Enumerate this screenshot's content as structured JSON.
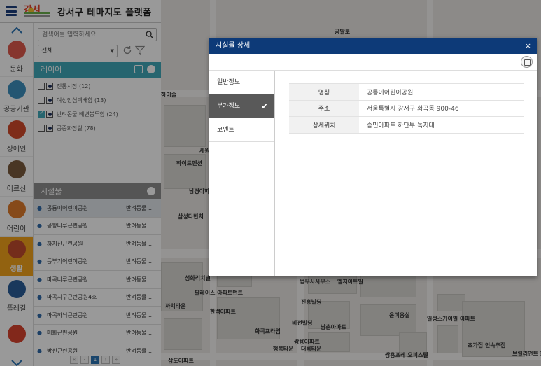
{
  "header": {
    "title": "강서구 테마지도 플랫폼",
    "logo_text": "강서"
  },
  "categories": [
    {
      "label": "문화",
      "icon": "culture-icon",
      "color": "#e05a4e"
    },
    {
      "label": "공공기관",
      "icon": "public-building-icon",
      "color": "#3d8fbf"
    },
    {
      "label": "장애인",
      "icon": "wheelchair-icon",
      "color": "#d24a2b"
    },
    {
      "label": "어르신",
      "icon": "elderly-icon",
      "color": "#7b5a3c"
    },
    {
      "label": "어린이",
      "icon": "child-icon",
      "color": "#e07c2c"
    },
    {
      "label": "생활",
      "icon": "living-icon",
      "color": "#c24b2e",
      "active": true
    },
    {
      "label": "플레길",
      "icon": "trail-icon",
      "color": "#2b5e9a"
    },
    {
      "label": "",
      "icon": "house-icon",
      "color": "#d9442e"
    }
  ],
  "search": {
    "placeholder": "검색어를 입력하세요"
  },
  "filter": {
    "selected": "전체"
  },
  "layer_section": {
    "title": "레이어"
  },
  "layers": [
    {
      "label": "전통시장 (12)",
      "checked": false
    },
    {
      "label": "여성안심택배함 (13)",
      "checked": false
    },
    {
      "label": "반려동물 배변봉투함 (24)",
      "checked": true
    },
    {
      "label": "공중화장실 (78)",
      "checked": false
    }
  ],
  "facility_section": {
    "title": "시설물"
  },
  "facilities": [
    {
      "name": "공룡이어린이공원",
      "type": "반려동물 ...",
      "selected": true
    },
    {
      "name": "공항나루근린공원",
      "type": "반려동물 ..."
    },
    {
      "name": "까치산근린공원",
      "type": "반려동물 ..."
    },
    {
      "name": "등부기어린이공원",
      "type": "반려동물 ..."
    },
    {
      "name": "마곡나루근린공원",
      "type": "반려동물 ..."
    },
    {
      "name": "마곡지구근린공원4호",
      "type": "반려동물 ..."
    },
    {
      "name": "마곡하늬근린공원",
      "type": "반려동물 ..."
    },
    {
      "name": "매화근린공원",
      "type": "반려동물 ..."
    },
    {
      "name": "방신근린공원",
      "type": "반려동물 ..."
    }
  ],
  "pager": {
    "first": "«",
    "prev": "‹",
    "current": "1",
    "next": "›",
    "last": "»"
  },
  "map_labels": [
    "하이트맨션",
    "남경아파트",
    "삼성다빈치",
    "성화리치빌",
    "팔레이스 아파트먼트",
    "한백아파트",
    "까치타운",
    "화곡프라임",
    "행복타운",
    "대록타운",
    "남촌아파트",
    "비전빌딩",
    "진흥빌딩",
    "법무사사무소",
    "엠지아트빌",
    "쌍용아파트",
    "일성스카이빌 아파트",
    "초가집 인속추점",
    "브릴리언트 화곡포레스트",
    "윤미용실",
    "쌍용포레 오피스텔",
    "삼도아파트",
    "세원",
    "하이술",
    "공발로"
  ],
  "modal": {
    "title": "시설물 상세",
    "close": "×",
    "tabs": [
      {
        "label": "일반정보",
        "active": false
      },
      {
        "label": "부가정보",
        "active": true
      },
      {
        "label": "코멘트",
        "active": false
      }
    ],
    "details": [
      {
        "key": "명칭",
        "value": "공룡이어린이공원"
      },
      {
        "key": "주소",
        "value": "서울특별시 강서구 화곡동 900-46"
      },
      {
        "key": "상세위치",
        "value": "송민아파트 하단부 녹지대"
      }
    ]
  }
}
